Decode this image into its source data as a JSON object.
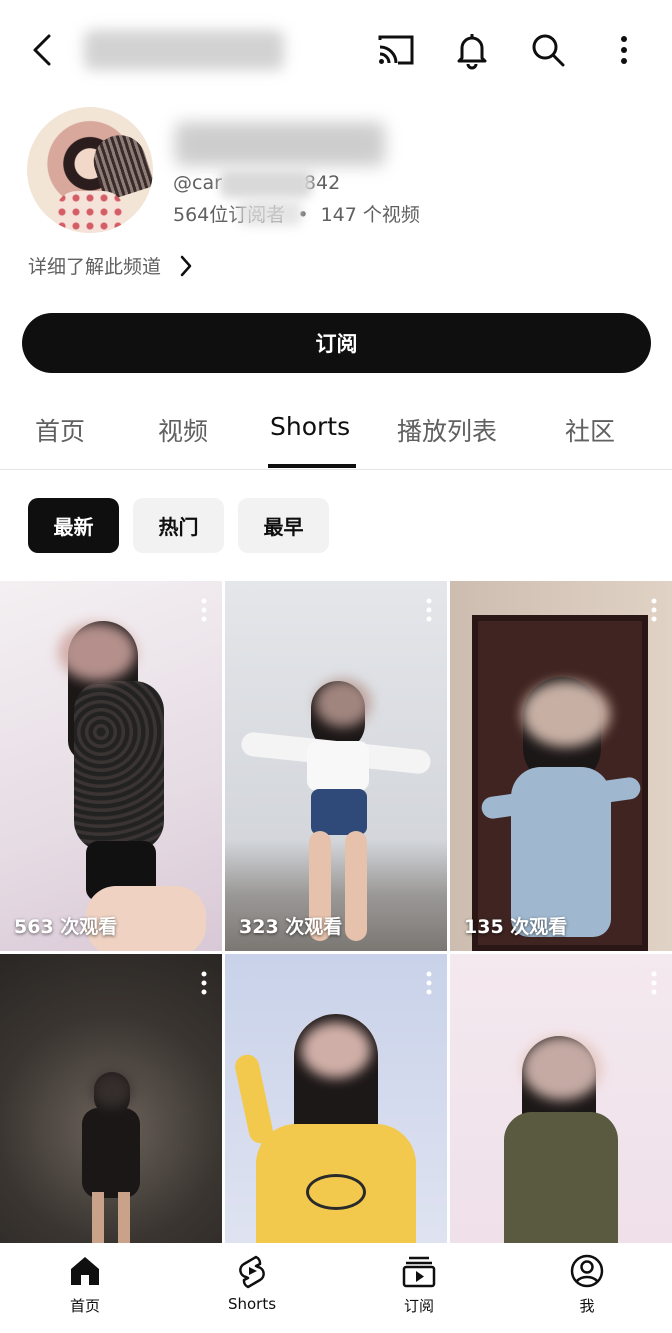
{
  "topbar": {
    "icons": [
      "back-icon",
      "cast-icon",
      "bell-icon",
      "search-icon",
      "more-vert-icon"
    ]
  },
  "channel": {
    "handle_prefix": "@car",
    "handle_suffix": "842",
    "subscribers": "564位订阅者",
    "videos": "147 个视频",
    "separator": "•",
    "more_info": "详细了解此频道"
  },
  "subscribe": {
    "label": "订阅"
  },
  "tabs": [
    {
      "label": "首页"
    },
    {
      "label": "视频"
    },
    {
      "label": "Shorts",
      "active": true
    },
    {
      "label": "播放列表"
    },
    {
      "label": "社区"
    }
  ],
  "filters": [
    {
      "label": "最新",
      "selected": true
    },
    {
      "label": "热门"
    },
    {
      "label": "最早"
    }
  ],
  "shorts": [
    {
      "views": "563 次观看"
    },
    {
      "views": "323 次观看"
    },
    {
      "views": "135 次观看"
    },
    {
      "views": ""
    },
    {
      "views": ""
    },
    {
      "views": ""
    }
  ],
  "bottom_nav": [
    {
      "label": "首页",
      "icon": "home-icon"
    },
    {
      "label": "Shorts",
      "icon": "shorts-icon"
    },
    {
      "label": "订阅",
      "icon": "subscriptions-icon"
    },
    {
      "label": "我",
      "icon": "account-icon"
    }
  ]
}
